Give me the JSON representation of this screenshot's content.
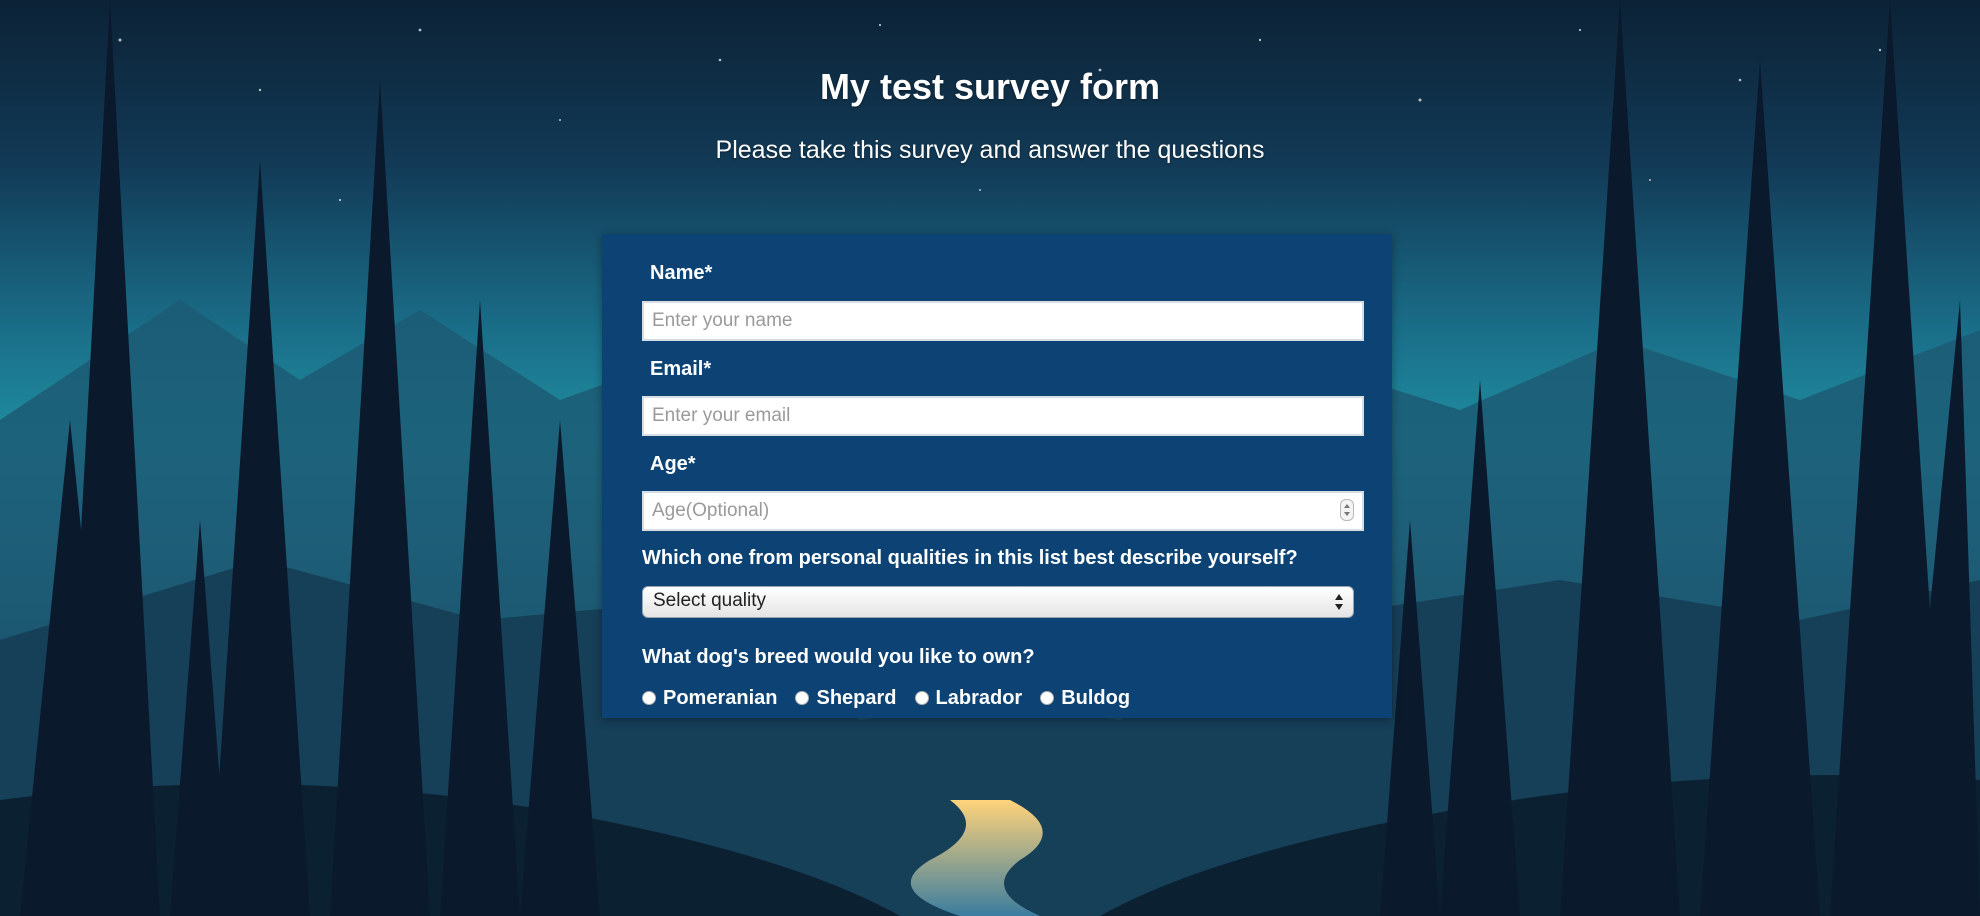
{
  "header": {
    "title": "My test survey form",
    "subtitle": "Please take this survey and answer the questions"
  },
  "form": {
    "name": {
      "label": "Name*",
      "placeholder": "Enter your name",
      "value": ""
    },
    "email": {
      "label": "Email*",
      "placeholder": "Enter your email",
      "value": ""
    },
    "age": {
      "label": "Age*",
      "placeholder": "Age(Optional)",
      "value": ""
    },
    "quality": {
      "question": "Which one from personal qualities in this list best describe yourself?",
      "selected": "Select quality"
    },
    "dog_breed": {
      "question": "What dog's breed would you like to own?",
      "options": [
        "Pomeranian",
        "Shepard",
        "Labrador",
        "Buldog"
      ]
    }
  },
  "colors": {
    "panel": "#0d4374",
    "text": "#ffffff"
  },
  "icons": {
    "age_spinner": "stepper-arrows-icon",
    "select_arrow": "select-arrows-icon"
  }
}
